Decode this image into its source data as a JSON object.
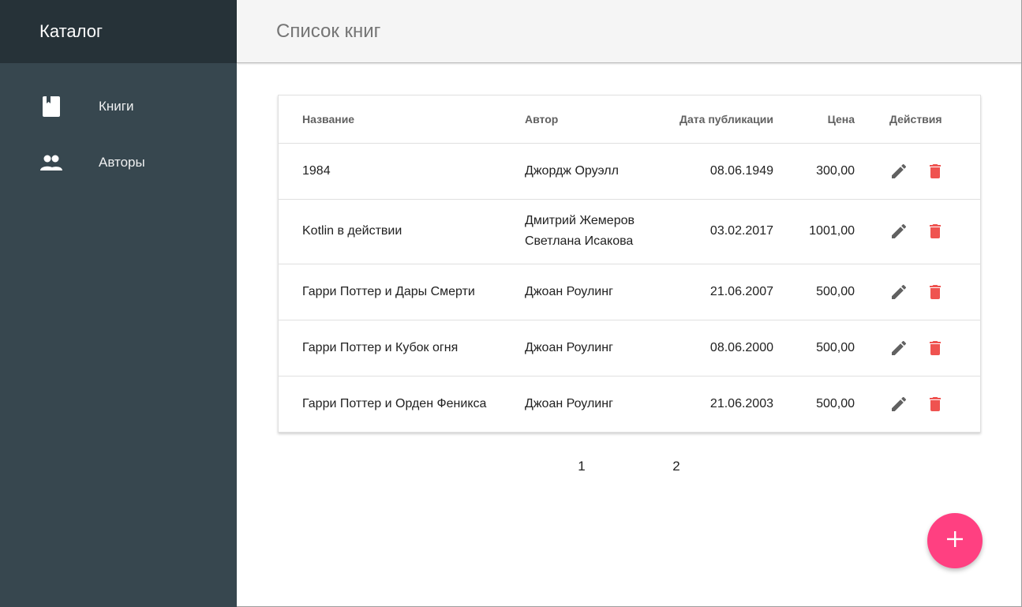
{
  "app": {
    "title": "Каталог"
  },
  "sidebar": {
    "items": [
      {
        "label": "Книги",
        "icon": "book-icon"
      },
      {
        "label": "Авторы",
        "icon": "people-icon"
      }
    ]
  },
  "header": {
    "title": "Список книг"
  },
  "table": {
    "columns": {
      "title": "Название",
      "author": "Автор",
      "date": "Дата публикации",
      "price": "Цена",
      "actions": "Действия"
    },
    "rows": [
      {
        "title": "1984",
        "authors": [
          "Джордж Оруэлл"
        ],
        "date": "08.06.1949",
        "price": "300,00"
      },
      {
        "title": "Kotlin в действии",
        "authors": [
          "Дмитрий Жемеров",
          "Светлана Исакова"
        ],
        "date": "03.02.2017",
        "price": "1001,00"
      },
      {
        "title": "Гарри Поттер и Дары Смерти",
        "authors": [
          "Джоан Роулинг"
        ],
        "date": "21.06.2007",
        "price": "500,00"
      },
      {
        "title": "Гарри Поттер и Кубок огня",
        "authors": [
          "Джоан Роулинг"
        ],
        "date": "08.06.2000",
        "price": "500,00"
      },
      {
        "title": "Гарри Поттер и Орден Феникса",
        "authors": [
          "Джоан Роулинг"
        ],
        "date": "21.06.2003",
        "price": "500,00"
      }
    ],
    "row_actions": {
      "edit_icon": "pencil-icon",
      "delete_icon": "trash-icon"
    }
  },
  "pagination": {
    "pages": [
      "1",
      "2"
    ]
  },
  "fab": {
    "icon": "plus-icon"
  },
  "colors": {
    "sidebar": "#37474f",
    "sidebar_header": "#263238",
    "topbar": "#f5f5f5",
    "edit_icon": "#616161",
    "delete_icon": "#ef5350",
    "fab": "#ff4081"
  }
}
